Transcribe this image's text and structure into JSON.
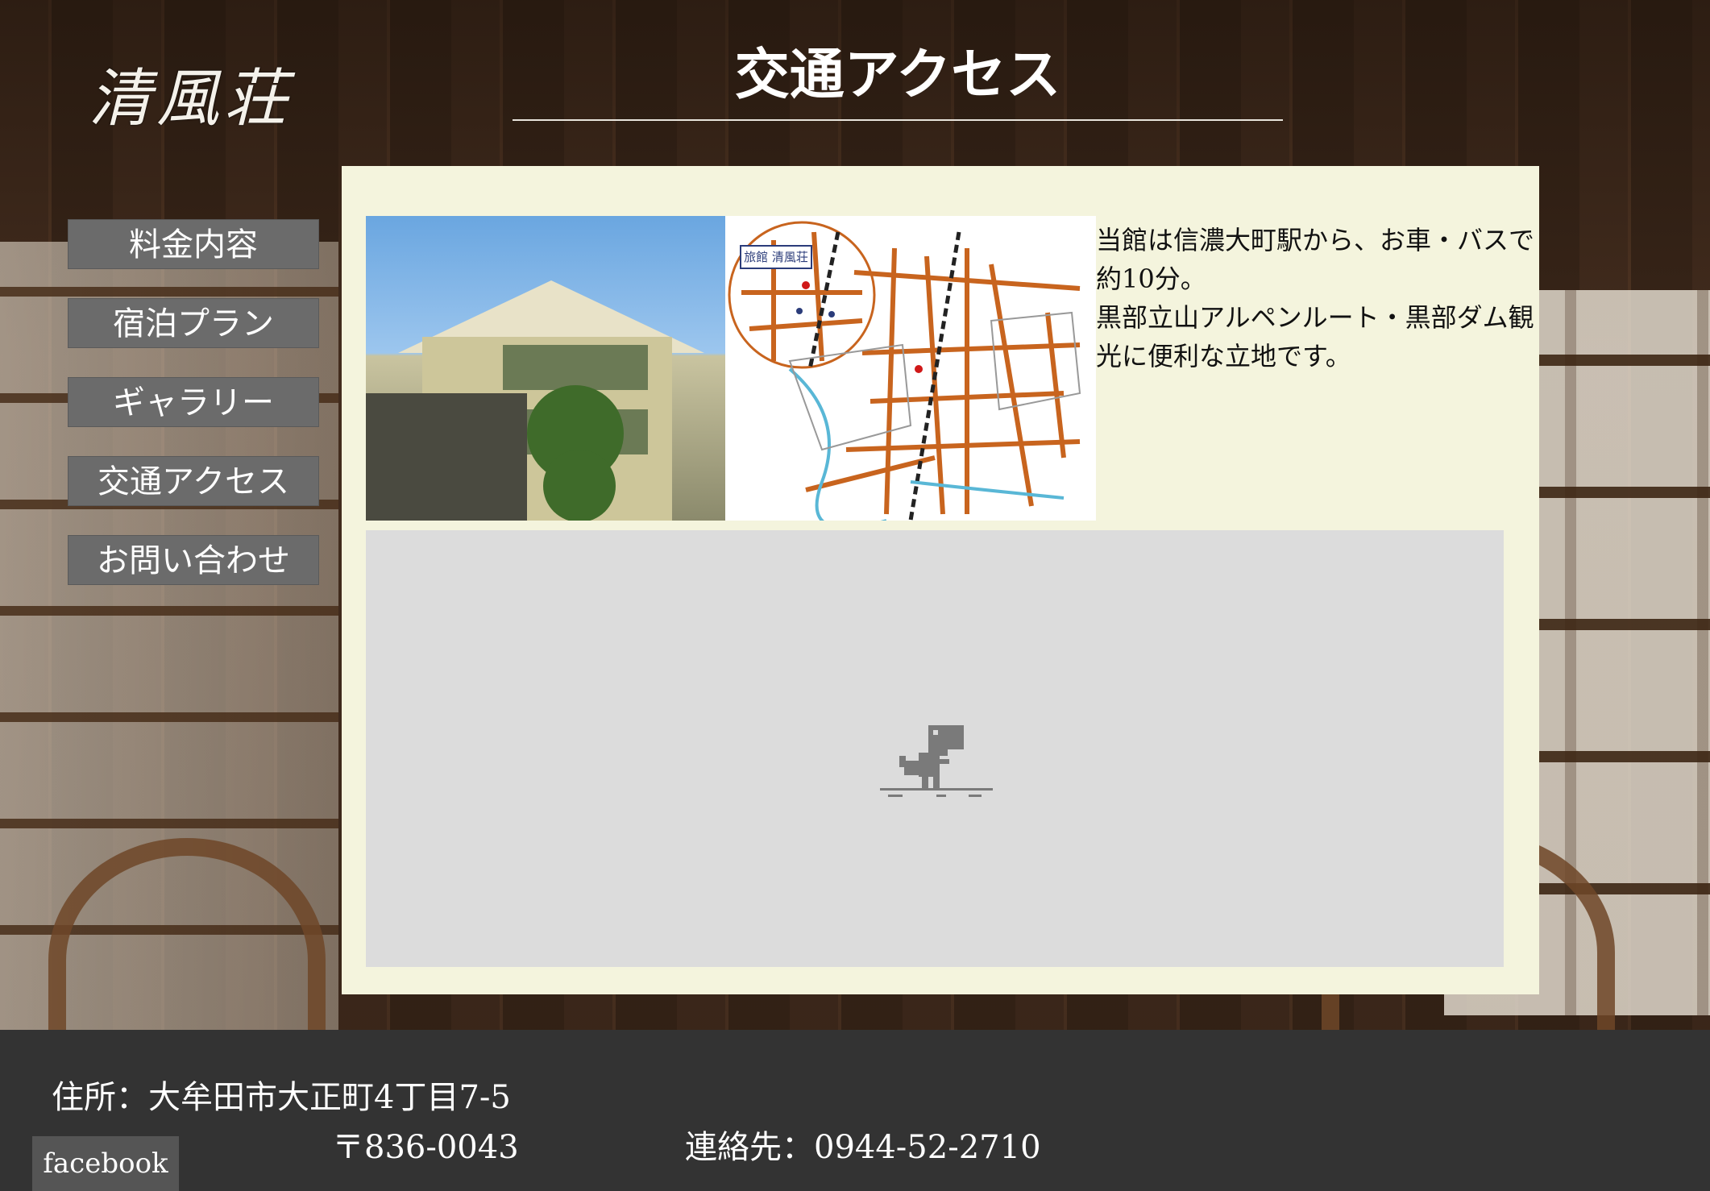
{
  "header": {
    "logo_text": "清風荘",
    "page_title": "交通アクセス"
  },
  "nav": {
    "items": [
      {
        "label": "料金内容"
      },
      {
        "label": "宿泊プラン"
      },
      {
        "label": "ギャラリー"
      },
      {
        "label": "交通アクセス"
      },
      {
        "label": "お問い合わせ"
      }
    ]
  },
  "main": {
    "map_image_label": "旅館 清風荘",
    "description_line1": "当館は信濃大町駅から、お車・バスで約10分。",
    "description_line2": "黒部立山アルペンルート・黒部ダム観光に便利な立地です。"
  },
  "footer": {
    "address": "住所：大牟田市大正町4丁目7-5",
    "postal_code": "〒836-0043",
    "contact": "連絡先：0944-52-2710",
    "facebook_label": "facebook"
  }
}
